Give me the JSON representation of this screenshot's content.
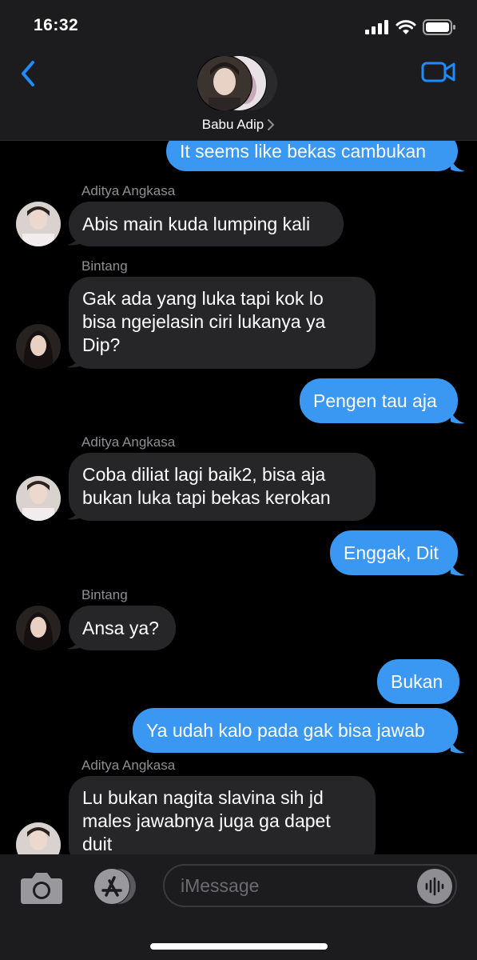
{
  "status_bar": {
    "time": "16:32"
  },
  "conversation": {
    "name": "Babu Adip",
    "chevron": "chevron-right-icon"
  },
  "colors": {
    "outgoing": "#3a98f3",
    "incoming": "#262629",
    "accent": "#1e8cff"
  },
  "messages": [
    {
      "direction": "out",
      "text": "It seems like bekas cambukan"
    },
    {
      "direction": "in",
      "sender": "Aditya Angkasa",
      "text": "Abis main kuda lumping kali"
    },
    {
      "direction": "in",
      "sender": "Bintang",
      "text": "Gak ada yang luka tapi kok lo bisa ngejelasin ciri lukanya ya Dip?"
    },
    {
      "direction": "out",
      "text": "Pengen tau aja"
    },
    {
      "direction": "in",
      "sender": "Aditya Angkasa",
      "text": "Coba diliat lagi baik2, bisa aja bukan luka tapi bekas kerokan"
    },
    {
      "direction": "out",
      "text": "Enggak, Dit"
    },
    {
      "direction": "in",
      "sender": "Bintang",
      "text": "Ansa ya?"
    },
    {
      "direction": "out",
      "text": "Bukan"
    },
    {
      "direction": "out",
      "text": "Ya udah kalo pada gak bisa jawab"
    },
    {
      "direction": "in",
      "sender": "Aditya Angkasa",
      "text": "Lu bukan nagita slavina sih jd males jawabnya juga ga dapet duit"
    }
  ],
  "input": {
    "placeholder": "iMessage"
  }
}
